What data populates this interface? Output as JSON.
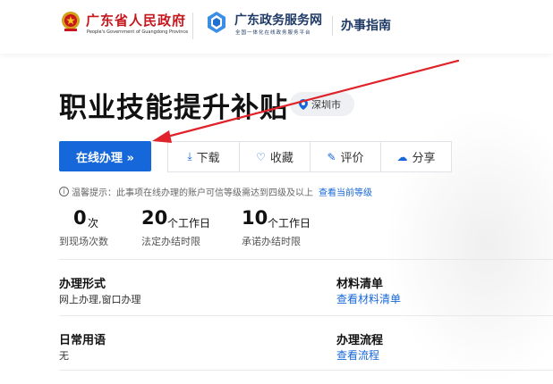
{
  "header": {
    "gov_name": "广东省人民政府",
    "gov_en": "People's Government of Guangdong Province",
    "service_name": "广东政务服务网",
    "service_sub": "全国一体化在线政务服务平台",
    "guide_label": "办事指南"
  },
  "title": "职业技能提升补贴",
  "location": "深圳市",
  "actions": {
    "online": "在线办理 »",
    "download": "下载",
    "favorite": "收藏",
    "review": "评价",
    "share": "分享"
  },
  "tip": {
    "text": "温馨提示：此事项在线办理的账户可信等级需达到四级及以上",
    "link": "查看当前等级"
  },
  "stats": [
    {
      "num": "0",
      "unit": "次",
      "label": "到现场次数"
    },
    {
      "num": "20",
      "unit": "个工作日",
      "label": "法定办结时限"
    },
    {
      "num": "10",
      "unit": "个工作日",
      "label": "承诺办结时限"
    }
  ],
  "sections": {
    "mode_title": "办理形式",
    "mode_value": "网上办理,窗口办理",
    "materials_title": "材料清单",
    "materials_link": "查看材料清单",
    "terms_title": "日常用语",
    "terms_value": "无",
    "process_title": "办理流程",
    "process_link": "查看流程"
  },
  "colors": {
    "primary": "#1667d9",
    "gov_red": "#c8161d",
    "arrow": "#e0232a"
  }
}
